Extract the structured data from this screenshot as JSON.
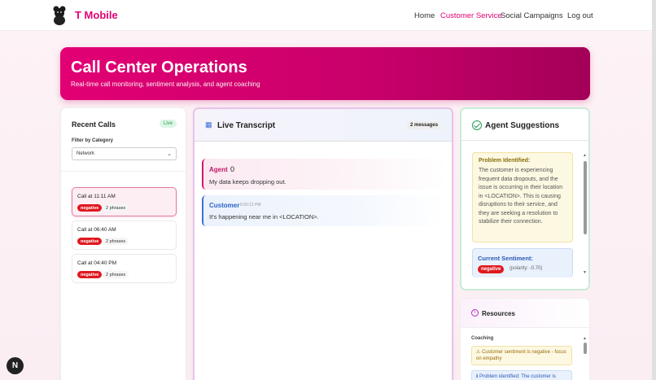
{
  "nav": {
    "brand": "T Mobile",
    "links": [
      "Home",
      "Customer Service",
      "Social Campaigns"
    ],
    "logout": "Log out",
    "active": "Customer Service",
    "logo_icon": "black-dog-logo",
    "accent_color": "#e20074"
  },
  "hero": {
    "title": "Call Center Operations",
    "subtitle": "Real-time call monitoring, sentiment analysis, and agent coaching"
  },
  "recent_calls": {
    "title": "Recent Calls",
    "live_badge": "Live",
    "filter_label": "Filter by Category",
    "filter_value": "Network",
    "calls": [
      {
        "time": "Call at 11:11 AM",
        "sentiment": "negative",
        "phrases": "2 phrases",
        "selected": true
      },
      {
        "time": "Call at 06:40 AM",
        "sentiment": "negative",
        "phrases": "2 phrases",
        "selected": false
      },
      {
        "time": "Call at 04:40 PM",
        "sentiment": "negative",
        "phrases": "2 phrases",
        "selected": false
      }
    ]
  },
  "transcript": {
    "title": "Live Transcript",
    "count": "2 messages",
    "messages": [
      {
        "speaker": "Agent",
        "extra": "0",
        "time": "",
        "text": "My data keeps dropping out."
      },
      {
        "speaker": "Customer",
        "extra": "",
        "time": "6:00:12 PM",
        "text": "It's happening near me in <LOCATION>."
      }
    ]
  },
  "suggestions": {
    "title": "Agent Suggestions",
    "problem_label": "Problem Identified:",
    "problem_text": "The customer is experiencing frequent data dropouts, and the issue is occurring in their location in <LOCATION>. This is causing disruptions to their service, and they are seeking a resolution to stabilize their connection.",
    "sentiment_label": "Current Sentiment:",
    "sentiment_badge": "negative",
    "polarity": "(polarity: -0.70)"
  },
  "resources": {
    "title": "Resources",
    "coaching_label": "Coaching",
    "tip_1": "Customer sentiment is negative - focus on empathy",
    "tip_2": "Problem identified: The customer is"
  },
  "corner_button": "N"
}
